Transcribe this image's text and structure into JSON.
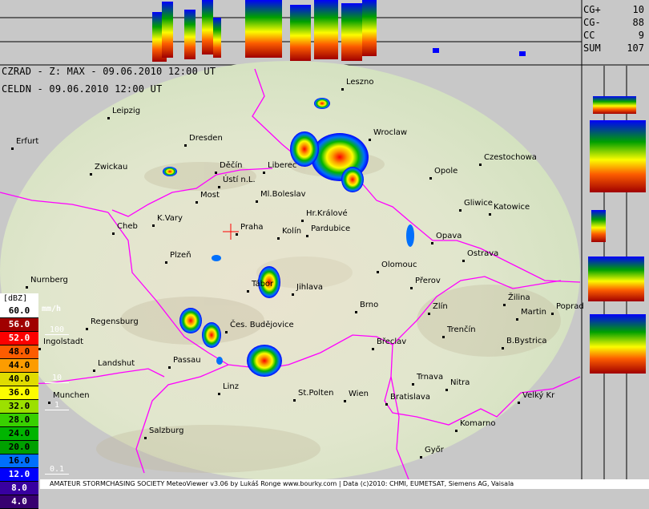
{
  "header": {
    "line1": "CZRAD - Z: MAX - 09.06.2010 12:00 UT",
    "line2": "CELDN - 09.06.2010 12:00 UT"
  },
  "stats": [
    {
      "label": "CG+",
      "value": "10"
    },
    {
      "label": "CG-",
      "value": "88"
    },
    {
      "label": "CC",
      "value": "9"
    },
    {
      "label": "SUM",
      "value": "107"
    }
  ],
  "legend": {
    "unit": "[dBZ]",
    "rain_unit": "mm/h",
    "steps": [
      {
        "label": "60.0",
        "color": "#ffffff",
        "text": "#000000"
      },
      {
        "label": "56.0",
        "color": "#a00000",
        "text": "#ffffff"
      },
      {
        "label": "52.0",
        "color": "#fc0000",
        "text": "#ffffff"
      },
      {
        "label": "48.0",
        "color": "#fc5c00",
        "text": "#000000"
      },
      {
        "label": "44.0",
        "color": "#fc9c00",
        "text": "#000000"
      },
      {
        "label": "40.0",
        "color": "#e0dc00",
        "text": "#000000"
      },
      {
        "label": "36.0",
        "color": "#fcfc00",
        "text": "#000000"
      },
      {
        "label": "32.0",
        "color": "#9ce000",
        "text": "#000000"
      },
      {
        "label": "28.0",
        "color": "#38d000",
        "text": "#000000"
      },
      {
        "label": "24.0",
        "color": "#00b400",
        "text": "#000000"
      },
      {
        "label": "20.0",
        "color": "#00a000",
        "text": "#000000"
      },
      {
        "label": "16.0",
        "color": "#0070fc",
        "text": "#000000"
      },
      {
        "label": "12.0",
        "color": "#0000fc",
        "text": "#ffffff"
      },
      {
        "label": "8.0",
        "color": "#3800a0",
        "text": "#ffffff"
      },
      {
        "label": "4.0",
        "color": "#380070",
        "text": "#ffffff"
      }
    ],
    "rain_rates": [
      "100",
      "10",
      "1",
      "0.1"
    ]
  },
  "cities": [
    {
      "name": "Leszno",
      "pos": [
        432,
        104
      ]
    },
    {
      "name": "Leipzig",
      "pos": [
        140,
        140
      ]
    },
    {
      "name": "Wroclaw",
      "pos": [
        466,
        167
      ]
    },
    {
      "name": "Dresden",
      "pos": [
        236,
        174
      ]
    },
    {
      "name": "Czestochowa",
      "pos": [
        604,
        198
      ]
    },
    {
      "name": "Erfurt",
      "pos": [
        20,
        178
      ]
    },
    {
      "name": "Zwickau",
      "pos": [
        118,
        210
      ]
    },
    {
      "name": "Děčín",
      "pos": [
        274,
        208
      ]
    },
    {
      "name": "Liberec",
      "pos": [
        334,
        208
      ]
    },
    {
      "name": "Opole",
      "pos": [
        542,
        215
      ]
    },
    {
      "name": "Ústí n.L.",
      "pos": [
        278,
        226
      ]
    },
    {
      "name": "Most",
      "pos": [
        250,
        245
      ]
    },
    {
      "name": "Ml.Boleslav",
      "pos": [
        325,
        244
      ]
    },
    {
      "name": "Gliwice",
      "pos": [
        579,
        255
      ]
    },
    {
      "name": "Katowice",
      "pos": [
        616,
        260
      ]
    },
    {
      "name": "Hr.Králové",
      "pos": [
        382,
        268
      ]
    },
    {
      "name": "K.Vary",
      "pos": [
        196,
        274
      ]
    },
    {
      "name": "Cheb",
      "pos": [
        146,
        284
      ]
    },
    {
      "name": "Praha",
      "pos": [
        300,
        285
      ]
    },
    {
      "name": "Pardubice",
      "pos": [
        388,
        287
      ]
    },
    {
      "name": "Kolín",
      "pos": [
        352,
        290
      ]
    },
    {
      "name": "Opava",
      "pos": [
        544,
        296
      ]
    },
    {
      "name": "Ostrava",
      "pos": [
        583,
        318
      ]
    },
    {
      "name": "Plzeň",
      "pos": [
        212,
        320
      ]
    },
    {
      "name": "Olomouc",
      "pos": [
        476,
        332
      ]
    },
    {
      "name": "Přerov",
      "pos": [
        518,
        352
      ]
    },
    {
      "name": "Nurnberg",
      "pos": [
        38,
        351
      ]
    },
    {
      "name": "Tábor",
      "pos": [
        314,
        356
      ]
    },
    {
      "name": "Jihlava",
      "pos": [
        370,
        360
      ]
    },
    {
      "name": "Žilina",
      "pos": [
        634,
        373
      ]
    },
    {
      "name": "Brno",
      "pos": [
        449,
        382
      ]
    },
    {
      "name": "Zlín",
      "pos": [
        540,
        384
      ]
    },
    {
      "name": "Poprad",
      "pos": [
        694,
        384
      ]
    },
    {
      "name": "Martin",
      "pos": [
        650,
        391
      ]
    },
    {
      "name": "Regensburg",
      "pos": [
        113,
        403
      ]
    },
    {
      "name": "Čes. Budějovice",
      "pos": [
        287,
        407
      ]
    },
    {
      "name": "Trenčín",
      "pos": [
        558,
        413
      ]
    },
    {
      "name": "Ingolstadt",
      "pos": [
        54,
        428
      ]
    },
    {
      "name": "Břeclav",
      "pos": [
        470,
        428
      ]
    },
    {
      "name": "B.Bystrica",
      "pos": [
        632,
        427
      ]
    },
    {
      "name": "Passau",
      "pos": [
        216,
        451
      ]
    },
    {
      "name": "Landshut",
      "pos": [
        122,
        455
      ]
    },
    {
      "name": "Trnava",
      "pos": [
        520,
        472
      ]
    },
    {
      "name": "Nitra",
      "pos": [
        562,
        479
      ]
    },
    {
      "name": "Linz",
      "pos": [
        278,
        484
      ]
    },
    {
      "name": "St.Polten",
      "pos": [
        372,
        492
      ]
    },
    {
      "name": "Wien",
      "pos": [
        435,
        493
      ]
    },
    {
      "name": "Munchen",
      "pos": [
        66,
        495
      ]
    },
    {
      "name": "Bratislava",
      "pos": [
        487,
        497
      ]
    },
    {
      "name": "Velký Kr",
      "pos": [
        652,
        495
      ]
    },
    {
      "name": "Komarno",
      "pos": [
        574,
        530
      ]
    },
    {
      "name": "Salzburg",
      "pos": [
        186,
        539
      ]
    },
    {
      "name": "Győr",
      "pos": [
        530,
        563
      ]
    }
  ],
  "footer": "AMATEUR STORMCHASING SOCIETY MeteoViewer v3.06 by Lukáš Ronge www.bourky.com | Data (c)2010: CHMI, EUMETSAT, Siemens AG, Vaisala"
}
